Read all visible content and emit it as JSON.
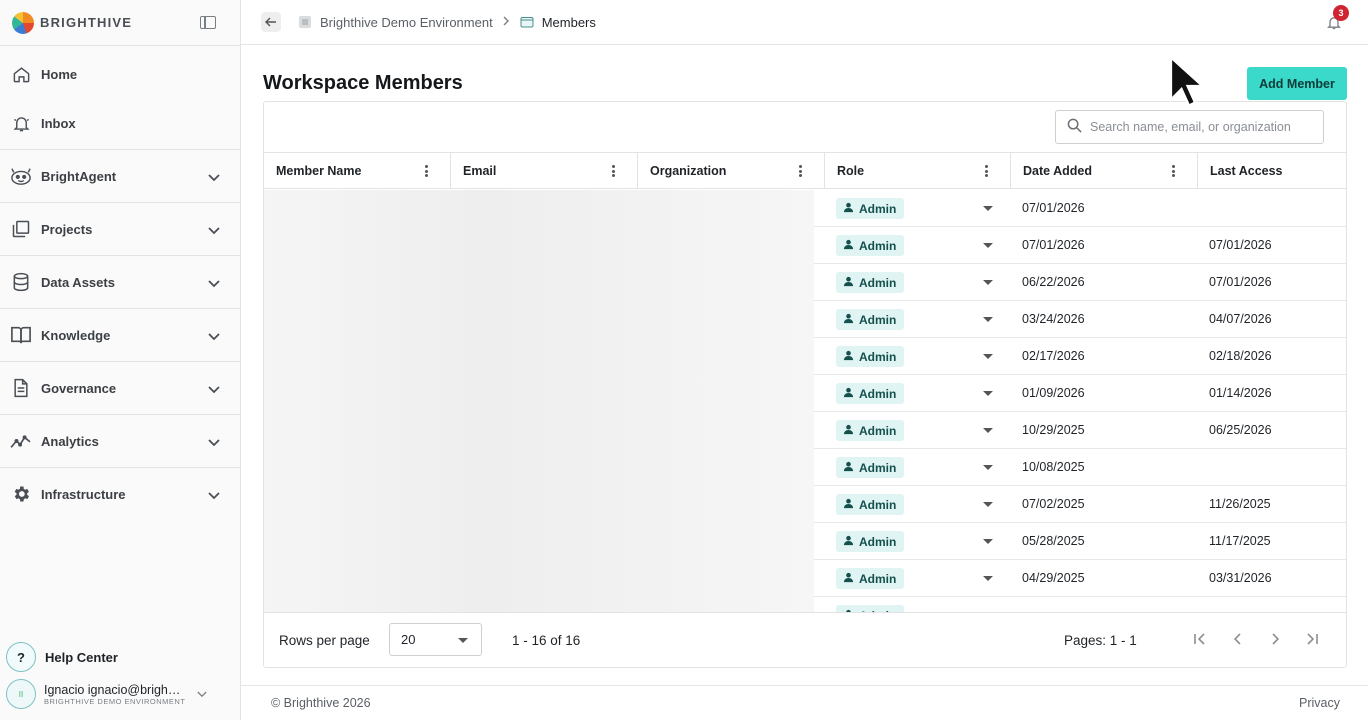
{
  "brand": {
    "name": "BRIGHTHIVE"
  },
  "sidebar": {
    "items": [
      {
        "label": "Home",
        "icon": "home-icon"
      },
      {
        "label": "Inbox",
        "icon": "bell-icon"
      },
      {
        "label": "BrightAgent",
        "icon": "agent-icon"
      },
      {
        "label": "Projects",
        "icon": "projects-icon"
      },
      {
        "label": "Data Assets",
        "icon": "database-icon"
      },
      {
        "label": "Knowledge",
        "icon": "book-icon"
      },
      {
        "label": "Governance",
        "icon": "document-icon"
      },
      {
        "label": "Analytics",
        "icon": "analytics-icon"
      },
      {
        "label": "Infrastructure",
        "icon": "gear-icon"
      }
    ],
    "help_label": "Help Center",
    "user": {
      "name": "Ignacio ignacio@brigh…",
      "environment": "BRIGHTHIVE DEMO ENVIRONMENT"
    }
  },
  "breadcrumb": {
    "environment": "Brighthive Demo Environment",
    "current": "Members"
  },
  "notifications": {
    "count": "3"
  },
  "page": {
    "title": "Workspace Members",
    "add_button": "Add Member"
  },
  "search": {
    "placeholder": "Search name, email, or organization"
  },
  "table": {
    "columns": [
      "Member Name",
      "Email",
      "Organization",
      "Role",
      "Date Added",
      "Last Access"
    ],
    "rows": [
      {
        "role": "Admin",
        "date_added": "07/01/2026",
        "last_access": ""
      },
      {
        "role": "Admin",
        "date_added": "07/01/2026",
        "last_access": "07/01/2026"
      },
      {
        "role": "Admin",
        "date_added": "06/22/2026",
        "last_access": "07/01/2026"
      },
      {
        "role": "Admin",
        "date_added": "03/24/2026",
        "last_access": "04/07/2026"
      },
      {
        "role": "Admin",
        "date_added": "02/17/2026",
        "last_access": "02/18/2026"
      },
      {
        "role": "Admin",
        "date_added": "01/09/2026",
        "last_access": "01/14/2026"
      },
      {
        "role": "Admin",
        "date_added": "10/29/2025",
        "last_access": "06/25/2026"
      },
      {
        "role": "Admin",
        "date_added": "10/08/2025",
        "last_access": ""
      },
      {
        "role": "Admin",
        "date_added": "07/02/2025",
        "last_access": "11/26/2025"
      },
      {
        "role": "Admin",
        "date_added": "05/28/2025",
        "last_access": "11/17/2025"
      },
      {
        "role": "Admin",
        "date_added": "04/29/2025",
        "last_access": "03/31/2026"
      },
      {
        "role": "Admin",
        "date_added": "",
        "last_access": ""
      }
    ]
  },
  "pagination": {
    "rows_per_page_label": "Rows per page",
    "rows_per_page_value": "20",
    "range": "1 - 16 of 16",
    "pages": "Pages: 1 - 1"
  },
  "footer": {
    "copyright": "© Brighthive 2026",
    "privacy": "Privacy"
  },
  "colors": {
    "accent": "#3ad9c9",
    "chip_bg": "#dff4f3",
    "chip_text": "#14504e",
    "badge": "#d02430"
  }
}
